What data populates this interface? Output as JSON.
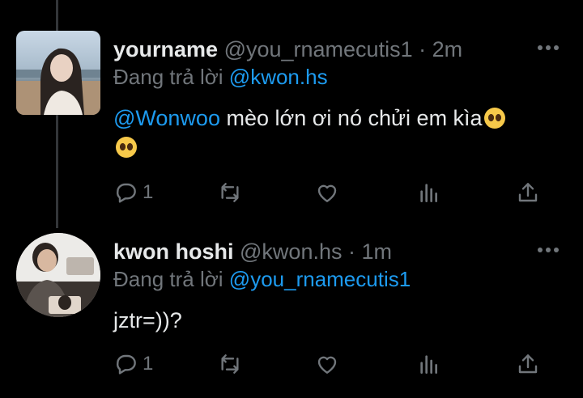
{
  "tweets": [
    {
      "display_name": "yourname",
      "handle": "@you_rnamecutis1",
      "separator": "·",
      "time": "2m",
      "reply_prefix": "Đang trả lời",
      "reply_handle": "@kwon.hs",
      "mention": "@Wonwoo",
      "text": " mèo lớn ơi nó chửi em kìa",
      "emoji": "pleading-face",
      "reply_count": "1"
    },
    {
      "display_name": "kwon hoshi",
      "handle": "@kwon.hs",
      "separator": "·",
      "time": "1m",
      "reply_prefix": "Đang trả lời",
      "reply_handle": "@you_rnamecutis1",
      "text": "jztr=))?",
      "reply_count": "1"
    }
  ],
  "colors": {
    "background": "#000000",
    "text": "#e7e9ea",
    "muted": "#71767b",
    "link": "#1d9bf0",
    "thread_line": "#333639"
  },
  "icons": [
    "reply-icon",
    "retweet-icon",
    "like-icon",
    "views-icon",
    "share-icon",
    "more-icon"
  ]
}
